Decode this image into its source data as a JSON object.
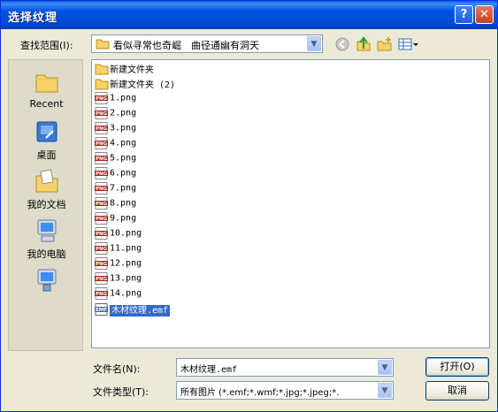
{
  "window": {
    "title": "选择纹理"
  },
  "lookin": {
    "label": "查找范围(I):",
    "value": "看似寻常也奇崛　曲径通幽有洞天"
  },
  "places": [
    {
      "label": "Recent",
      "icon": "recent-folder-icon"
    },
    {
      "label": "桌面",
      "icon": "desktop-icon"
    },
    {
      "label": "我的文档",
      "icon": "my-documents-icon"
    },
    {
      "label": "我的电脑",
      "icon": "my-computer-icon"
    },
    {
      "label": "",
      "icon": "network-places-icon"
    }
  ],
  "files": [
    {
      "name": "新建文件夹",
      "type": "folder"
    },
    {
      "name": "新建文件夹 (2)",
      "type": "folder"
    },
    {
      "name": "1.png",
      "type": "png"
    },
    {
      "name": "2.png",
      "type": "png"
    },
    {
      "name": "3.png",
      "type": "png"
    },
    {
      "name": "4.png",
      "type": "png"
    },
    {
      "name": "5.png",
      "type": "png"
    },
    {
      "name": "6.png",
      "type": "png"
    },
    {
      "name": "7.png",
      "type": "png"
    },
    {
      "name": "8.png",
      "type": "png"
    },
    {
      "name": "9.png",
      "type": "png"
    },
    {
      "name": "10.png",
      "type": "png"
    },
    {
      "name": "11.png",
      "type": "png"
    },
    {
      "name": "12.png",
      "type": "png"
    },
    {
      "name": "13.png",
      "type": "png"
    },
    {
      "name": "14.png",
      "type": "png"
    },
    {
      "name": "木材纹理.emf",
      "type": "emf",
      "selected": true
    }
  ],
  "filename": {
    "label": "文件名(N):",
    "value": "木材纹理.emf"
  },
  "filetype": {
    "label": "文件类型(T):",
    "value": "所有图片 (*.emf;*.wmf;*.jpg;*.jpeg;*."
  },
  "buttons": {
    "open": "打开(O)",
    "cancel": "取消"
  },
  "colors": {
    "selection": "#316ac5",
    "titlebar": "#0054e3",
    "face": "#ece9d8"
  }
}
